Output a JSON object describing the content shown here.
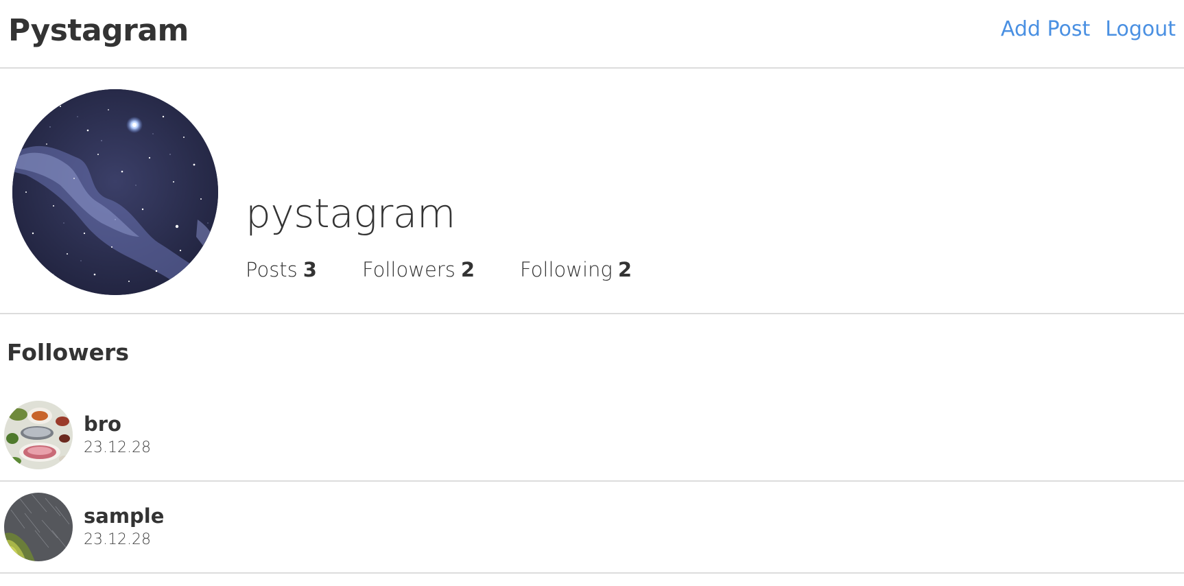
{
  "header": {
    "brand": "Pystagram",
    "nav": {
      "add_post": "Add Post",
      "logout": "Logout"
    }
  },
  "profile": {
    "username": "pystagram",
    "stats": {
      "posts_label": "Posts",
      "posts_count": "3",
      "followers_label": "Followers",
      "followers_count": "2",
      "following_label": "Following",
      "following_count": "2"
    }
  },
  "followers_section": {
    "title": "Followers",
    "items": [
      {
        "name": "bro",
        "date": "23.12.28"
      },
      {
        "name": "sample",
        "date": "23.12.28"
      }
    ]
  },
  "colors": {
    "link": "#4a90e2",
    "text": "#333333",
    "divider": "#dcdcdc"
  }
}
